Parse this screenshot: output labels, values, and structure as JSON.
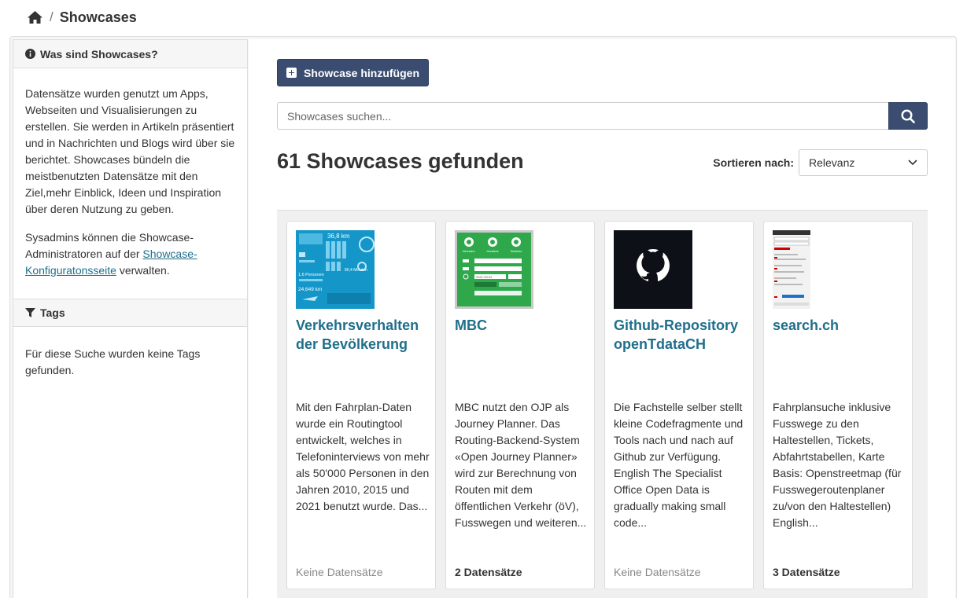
{
  "breadcrumb": {
    "separator": "/",
    "current": "Showcases"
  },
  "sidebar": {
    "info": {
      "heading": "Was sind Showcases?",
      "paragraph1": "Datensätze wurden genutzt um Apps, Webseiten und Visualisierungen zu erstellen. Sie werden in Artikeln präsentiert und in Nachrichten und Blogs wird über sie berichtet. Showcases bündeln die meistbenutzten Datensätze mit den Ziel,mehr Einblick, Ideen und Inspiration über deren Nutzung zu geben.",
      "para2_before": "Sysadmins können die Showcase-Administratoren auf der ",
      "para2_link": "Showcase-Konfiguratonsseite",
      "para2_after": " verwalten."
    },
    "tags": {
      "heading": "Tags",
      "empty": "Für diese Suche wurden keine Tags gefunden."
    }
  },
  "main": {
    "add_button": "Showcase hinzufügen",
    "search": {
      "placeholder": "Showcases suchen..."
    },
    "count_heading": "61 Showcases gefunden",
    "sort": {
      "label": "Sortieren nach:",
      "value": "Relevanz"
    }
  },
  "thumbs": {
    "verkehr": {
      "km1": "36,8 km",
      "persons": "1,6 Personen",
      "minutes": "80,4 Minuten",
      "km2": "24,649 km"
    },
    "mbc": {
      "tabs": [
        "Itineraire",
        "Horaires",
        "Stations"
      ],
      "date": "2021-09-02"
    }
  },
  "cards": [
    {
      "title": "Verkehrsverhalten der Bevölkerung",
      "description": "Mit den Fahrplan-Daten wurde ein Routingtool entwickelt, welches in Telefoninterviews von mehr als 50'000 Personen in den Jahren 2010, 2015 und 2021 benutzt wurde. Das...",
      "datasets": "Keine Datensätze"
    },
    {
      "title": "MBC",
      "description": "MBC nutzt den OJP als Journey Planner. Das Routing-Backend-System «Open Journey Planner» wird zur Berechnung von Routen mit dem öffentlichen Verkehr (öV), Fusswegen und weiteren...",
      "datasets": "2 Datensätze"
    },
    {
      "title": "Github-Repository openTdataCH",
      "description": "Die Fachstelle selber stellt kleine Codefragmente und Tools nach und nach auf Github zur Verfügung. English The Specialist Office Open Data is gradually making small code...",
      "datasets": "Keine Datensätze"
    },
    {
      "title": "search.ch",
      "description": "Fahrplansuche inklusive Fusswege zu den Haltestellen, Tickets, Abfahrtstabellen, Karte Basis: Openstreetmap (für Fusswegeroutenplaner zu/von den Haltestellen) English...",
      "datasets": "3 Datensätze"
    }
  ],
  "colors": {
    "primary": "#3a4d71",
    "link": "#1f6f8b",
    "muted": "#888888"
  }
}
